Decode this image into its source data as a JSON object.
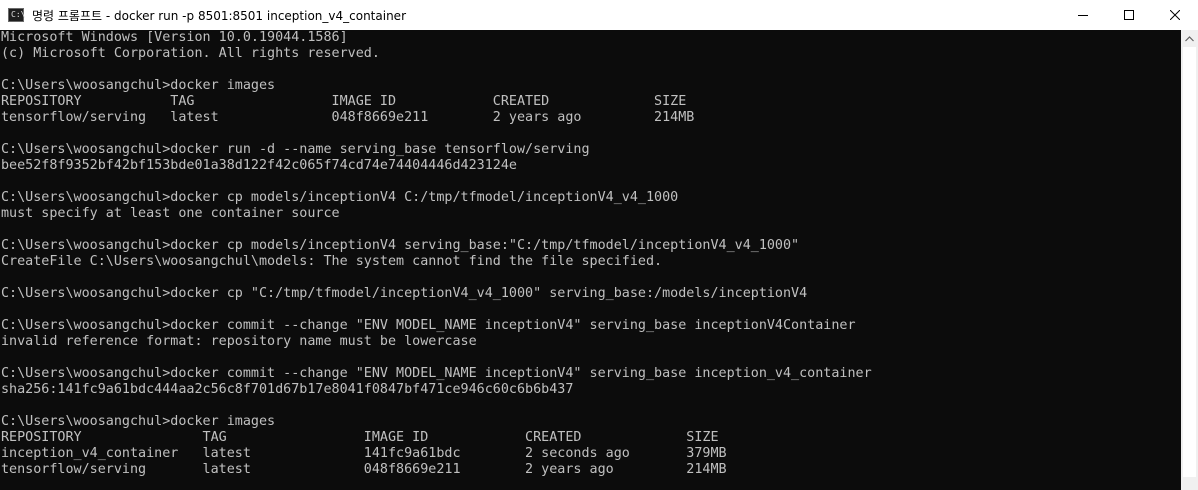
{
  "window": {
    "title": "명령 프롬프트 - docker  run -p 8501:8501 inception_v4_container",
    "app_icon_text": "C:\\"
  },
  "controls": {
    "minimize_icon": "minimize-icon",
    "maximize_icon": "maximize-icon",
    "close_icon": "close-icon"
  },
  "terminal": {
    "lines": [
      "Microsoft Windows [Version 10.0.19044.1586]",
      "(c) Microsoft Corporation. All rights reserved.",
      "",
      "C:\\Users\\woosangchul>docker images",
      "REPOSITORY           TAG                 IMAGE ID            CREATED             SIZE",
      "tensorflow/serving   latest              048f8669e211        2 years ago         214MB",
      "",
      "C:\\Users\\woosangchul>docker run -d --name serving_base tensorflow/serving",
      "bee52f8f9352bf42bf153bde01a38d122f42c065f74cd74e74404446d423124e",
      "",
      "C:\\Users\\woosangchul>docker cp models/inceptionV4 C:/tmp/tfmodel/inceptionV4_v4_1000",
      "must specify at least one container source",
      "",
      "C:\\Users\\woosangchul>docker cp models/inceptionV4 serving_base:\"C:/tmp/tfmodel/inceptionV4_v4_1000\"",
      "CreateFile C:\\Users\\woosangchul\\models: The system cannot find the file specified.",
      "",
      "C:\\Users\\woosangchul>docker cp \"C:/tmp/tfmodel/inceptionV4_v4_1000\" serving_base:/models/inceptionV4",
      "",
      "C:\\Users\\woosangchul>docker commit --change \"ENV MODEL_NAME inceptionV4\" serving_base inceptionV4Container",
      "invalid reference format: repository name must be lowercase",
      "",
      "C:\\Users\\woosangchul>docker commit --change \"ENV MODEL_NAME inceptionV4\" serving_base inception_v4_container",
      "sha256:141fc9a61bdc444aa2c56c8f701d67b17e8041f0847bf471ce946c60c6b6b437",
      "",
      "C:\\Users\\woosangchul>docker images",
      "REPOSITORY               TAG                 IMAGE ID            CREATED             SIZE",
      "inception_v4_container   latest              141fc9a61bdc        2 seconds ago       379MB",
      "tensorflow/serving       latest              048f8669e211        2 years ago         214MB"
    ]
  },
  "colors": {
    "terminal_bg": "#0c0c0c",
    "terminal_fg": "#c0c0c0",
    "titlebar_bg": "#ffffff"
  }
}
